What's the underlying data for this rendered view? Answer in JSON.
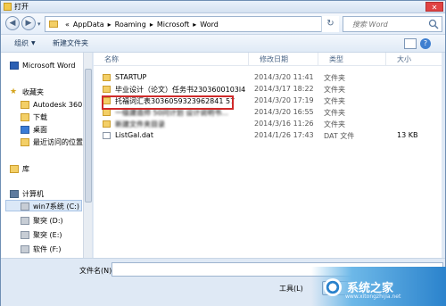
{
  "window": {
    "title": "打开"
  },
  "nav": {
    "breadcrumbs": [
      "AppData",
      "Roaming",
      "Microsoft",
      "Word"
    ],
    "search_placeholder": "搜索 Word"
  },
  "toolbar": {
    "organize": "组织",
    "new_folder": "新建文件夹"
  },
  "sidebar": {
    "items": [
      {
        "label": "Microsoft Word",
        "icon": "word-icon"
      },
      {
        "label": "收藏夹",
        "icon": "star-icon"
      },
      {
        "label": "Autodesk 360",
        "icon": "folder-icon"
      },
      {
        "label": "下载",
        "icon": "folder-icon"
      },
      {
        "label": "桌面",
        "icon": "desktop-icon"
      },
      {
        "label": "最近访问的位置",
        "icon": "folder-icon"
      },
      {
        "label": "库",
        "icon": "library-icon"
      },
      {
        "label": "计算机",
        "icon": "computer-icon"
      },
      {
        "label": "win7系统 (C:)",
        "icon": "drive-icon"
      },
      {
        "label": "聚突 (D:)",
        "icon": "drive-icon"
      },
      {
        "label": "聚突 (E:)",
        "icon": "drive-icon"
      },
      {
        "label": "软件 (F:)",
        "icon": "drive-icon"
      }
    ]
  },
  "columns": {
    "name": "名称",
    "date": "修改日期",
    "type": "类型",
    "size": "大小"
  },
  "files": [
    {
      "name": "STARTUP",
      "date": "2014/3/20 11:41",
      "type": "文件夹",
      "size": ""
    },
    {
      "name": "毕业设计（论文）任务书2303600103l4...",
      "date": "2014/3/17 18:22",
      "type": "文件夹",
      "size": ""
    },
    {
      "name": "托福词汇表3036059323962841 57",
      "date": "2014/3/20 17:19",
      "type": "文件夹",
      "size": ""
    },
    {
      "name": "一级建造师 50问计划 设计说明书...",
      "date": "2014/3/20 16:55",
      "type": "文件夹",
      "size": ""
    },
    {
      "name": "新建文件夹目录",
      "date": "2014/3/16 11:26",
      "type": "文件夹",
      "size": ""
    },
    {
      "name": "ListGal.dat",
      "date": "2014/1/26 17:43",
      "type": "DAT 文件",
      "size": "13 KB"
    }
  ],
  "bottom": {
    "filename_label": "文件名(N):",
    "tools_label": "工具(L)"
  },
  "watermark": {
    "text": "系统之家",
    "sub": "www.xitongzhijia.net"
  }
}
